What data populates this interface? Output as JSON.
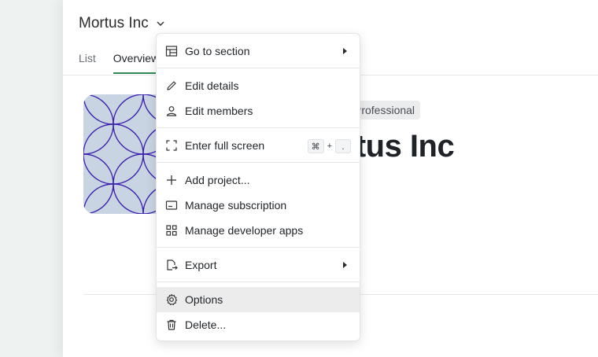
{
  "workspace": {
    "title": "Mortus Inc"
  },
  "tabs": [
    {
      "label": "List"
    },
    {
      "label": "Overview",
      "active": true
    }
  ],
  "overview": {
    "plan_badge": "Professional",
    "name": "Mortus Inc"
  },
  "menu": {
    "items": [
      {
        "label": "Go to section",
        "icon": "layout-icon",
        "submenu": true
      },
      {
        "label": "Edit details",
        "icon": "pencil-icon"
      },
      {
        "label": "Edit members",
        "icon": "person-icon"
      },
      {
        "label": "Enter full screen",
        "icon": "fullscreen-icon",
        "shortcut": [
          "⌘",
          "+",
          "."
        ]
      },
      {
        "label": "Add project...",
        "icon": "plus-icon"
      },
      {
        "label": "Manage subscription",
        "icon": "card-icon"
      },
      {
        "label": "Manage developer apps",
        "icon": "grid-icon"
      },
      {
        "label": "Export",
        "icon": "export-icon",
        "submenu": true
      },
      {
        "label": "Options",
        "icon": "gear-icon",
        "highlighted": true
      },
      {
        "label": "Delete...",
        "icon": "trash-icon"
      }
    ]
  },
  "colors": {
    "accent_tab": "#2f8a53",
    "cover_bg": "#c8d4e2",
    "cover_pattern": "#3a1fb0",
    "menu_highlight": "#ececec"
  }
}
